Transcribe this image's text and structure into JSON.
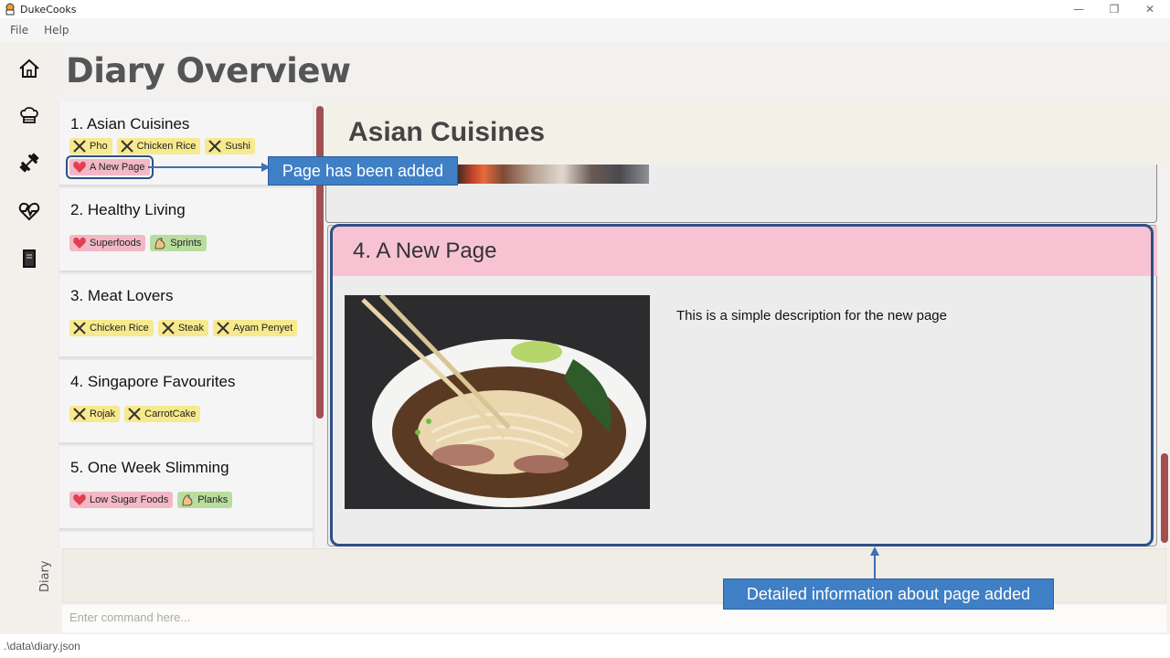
{
  "window": {
    "title": "DukeCooks",
    "icon": "chef-hat-icon",
    "controls": {
      "minimize": "—",
      "restore": "❐",
      "close": "✕"
    }
  },
  "menu": {
    "items": [
      "File",
      "Help"
    ]
  },
  "sidebar": {
    "icons": [
      "home-icon",
      "recipe-chef-icon",
      "exercise-dumbbell-icon",
      "health-heartbeat-icon",
      "diary-book-icon"
    ],
    "label": "Diary"
  },
  "header": {
    "title": "Diary Overview"
  },
  "diaries": [
    {
      "title": "1.  Asian Cuisines",
      "tags": [
        {
          "label": "Pho",
          "type": "food"
        },
        {
          "label": "Chicken Rice",
          "type": "food"
        },
        {
          "label": "Sushi",
          "type": "food"
        },
        {
          "label": "A New Page",
          "type": "health",
          "selected": true
        }
      ]
    },
    {
      "title": "2.  Healthy Living",
      "tags": [
        {
          "label": "Superfoods",
          "type": "health"
        },
        {
          "label": "Sprints",
          "type": "exercise"
        }
      ]
    },
    {
      "title": "3.  Meat Lovers",
      "tags": [
        {
          "label": "Chicken Rice",
          "type": "food"
        },
        {
          "label": "Steak",
          "type": "food"
        },
        {
          "label": "Ayam Penyet",
          "type": "food"
        }
      ]
    },
    {
      "title": "4.  Singapore Favourites",
      "tags": [
        {
          "label": "Rojak",
          "type": "food"
        },
        {
          "label": "CarrotCake",
          "type": "food"
        }
      ]
    },
    {
      "title": "5.  One Week Slimming",
      "tags": [
        {
          "label": "Low Sugar Foods",
          "type": "health"
        },
        {
          "label": "Planks",
          "type": "exercise"
        }
      ]
    }
  ],
  "detail": {
    "section_title": "Asian Cuisines",
    "page_title": "4. A New Page",
    "page_description": "This is a simple description for the new page"
  },
  "command": {
    "placeholder": "Enter command here..."
  },
  "status": {
    "path": ".\\data\\diary.json"
  },
  "annotations": {
    "page_added": "Page has been added",
    "detail_info": "Detailed information about page added"
  },
  "colors": {
    "food_tag": "#f7e98d",
    "health_tag": "#f2b8c6",
    "exercise_tag": "#b9dd9e",
    "scroll_thumb": "#a05050",
    "highlight": "#2f4f86",
    "callout": "#3f7fc5"
  }
}
